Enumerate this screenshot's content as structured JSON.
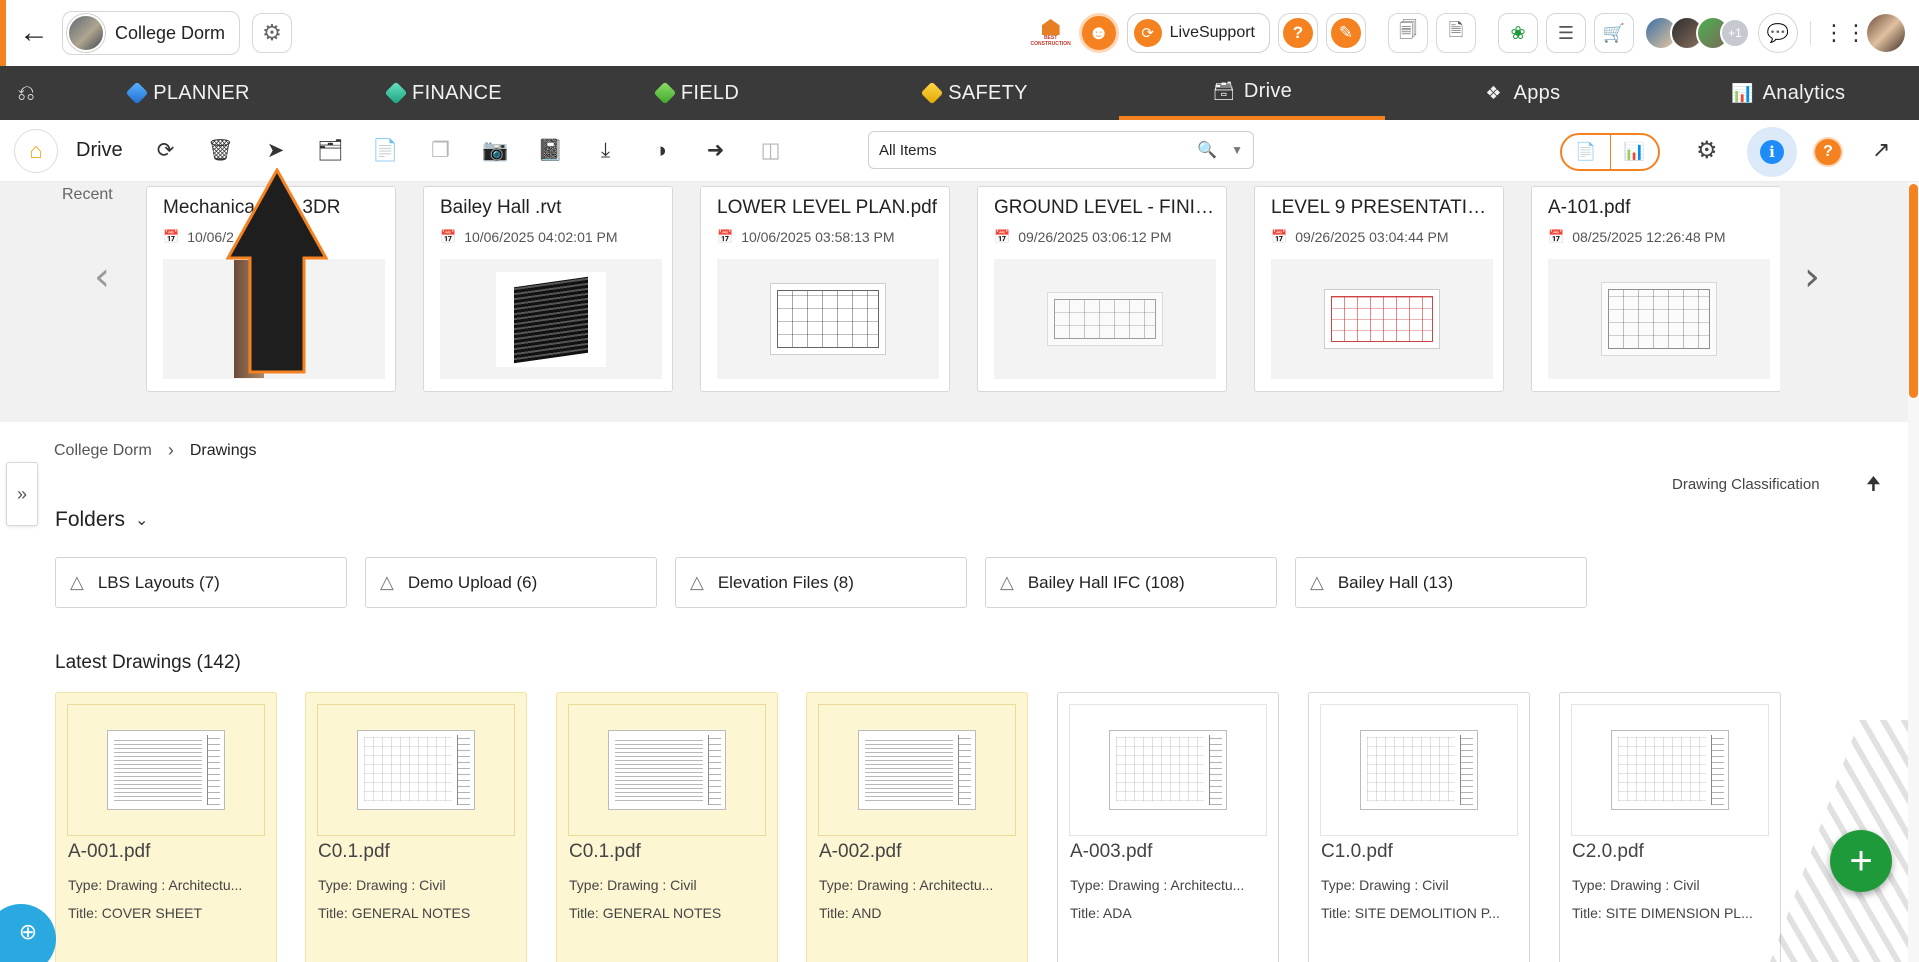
{
  "topbar": {
    "project_name": "College Dorm",
    "livesupport_label": "LiveSupport",
    "help_label": "?",
    "more_members": "+1",
    "logo_text": "BEST CONSTRUCTION",
    "icons": [
      "back-arrow-icon",
      "settings-icon",
      "best-logo",
      "mascot-icon",
      "livesupport-icon",
      "help-icon",
      "pencil-icon",
      "form-icon",
      "document-icon",
      "leaf-icon",
      "checklist-icon",
      "cart-icon",
      "chat-icon",
      "apps-grid-icon"
    ]
  },
  "nav": {
    "items": [
      {
        "label": "PLANNER",
        "icon": "planner-icon"
      },
      {
        "label": "FINANCE",
        "icon": "finance-icon"
      },
      {
        "label": "FIELD",
        "icon": "field-icon"
      },
      {
        "label": "SAFETY",
        "icon": "safety-icon"
      },
      {
        "label": "Drive",
        "icon": "drive-icon",
        "active": true
      },
      {
        "label": "Apps",
        "icon": "apps-icon"
      },
      {
        "label": "Analytics",
        "icon": "analytics-icon"
      }
    ],
    "accent_color": "#f58220"
  },
  "toolbar": {
    "title": "Drive",
    "search_value": "All Items",
    "info_label": "i",
    "help_label": "?"
  },
  "recent": {
    "label": "Recent",
    "items": [
      {
        "name": "Mechanical Room.3DR",
        "shown": "Mechanica   oom.3DR",
        "date": "10/06/2025 04:03:11 PM",
        "shown_date": "10/06/2        1 PM"
      },
      {
        "name": "Bailey Hall .rvt",
        "date": "10/06/2025 04:02:01 PM"
      },
      {
        "name": "LOWER LEVEL PLAN.pdf",
        "date": "10/06/2025 03:58:13 PM"
      },
      {
        "name": "GROUND LEVEL - FINIS...",
        "date": "09/26/2025 03:06:12 PM"
      },
      {
        "name": "LEVEL 9 PRESENTATIO...",
        "date": "09/26/2025 03:04:44 PM"
      },
      {
        "name": "A-101.pdf",
        "date": "08/25/2025 12:26:48 PM"
      }
    ]
  },
  "breadcrumb": {
    "root": "College Dorm",
    "current": "Drawings"
  },
  "sort": {
    "label": "Drawing Classification"
  },
  "folders": {
    "heading": "Folders",
    "items": [
      {
        "label": "LBS Layouts (7)"
      },
      {
        "label": "Demo Upload (6)"
      },
      {
        "label": "Elevation Files (8)"
      },
      {
        "label": "Bailey Hall IFC (108)"
      },
      {
        "label": "Bailey Hall (13)"
      }
    ]
  },
  "latest": {
    "heading": "Latest Drawings (142)",
    "items": [
      {
        "name": "A-001.pdf",
        "type": "Type: Drawing : Architectu...",
        "title": "Title: COVER SHEET",
        "highlight": true
      },
      {
        "name": "C0.1.pdf",
        "type": "Type: Drawing : Civil",
        "title": "Title: GENERAL NOTES",
        "highlight": true
      },
      {
        "name": "C0.1.pdf",
        "type": "Type: Drawing : Civil",
        "title": "Title: GENERAL NOTES",
        "highlight": true
      },
      {
        "name": "A-002.pdf",
        "type": "Type: Drawing : Architectu...",
        "title": "Title: AND",
        "highlight": true
      },
      {
        "name": "A-003.pdf",
        "type": "Type: Drawing : Architectu...",
        "title": "Title: ADA",
        "highlight": false
      },
      {
        "name": "C1.0.pdf",
        "type": "Type: Drawing : Civil",
        "title": "Title: SITE DEMOLITION P...",
        "highlight": false
      },
      {
        "name": "C2.0.pdf",
        "type": "Type: Drawing : Civil",
        "title": "Title: SITE DIMENSION PL...",
        "highlight": false
      }
    ]
  },
  "fab_label": "+"
}
